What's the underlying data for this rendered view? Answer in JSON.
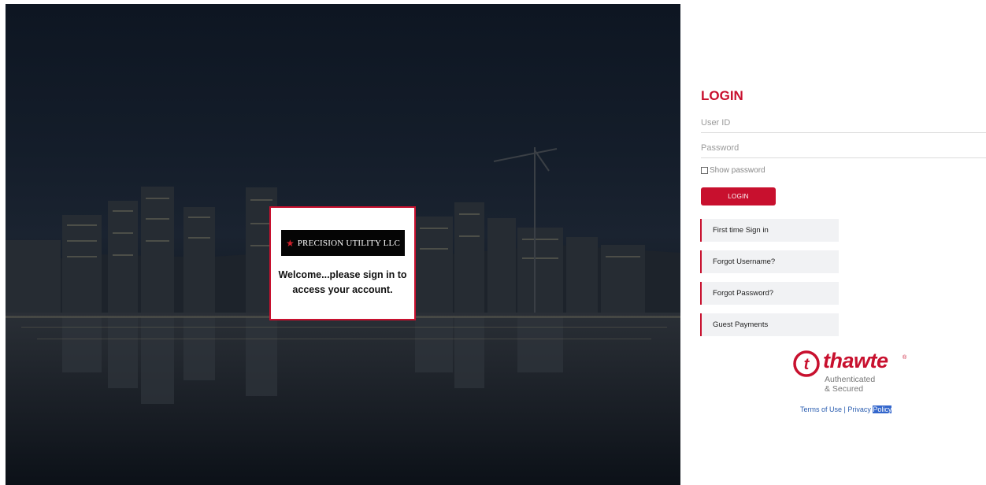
{
  "brand": {
    "name": "PRECISION UTILITY LLC",
    "star_glyph": "★",
    "welcome_message": "Welcome...please sign in to access your account."
  },
  "login": {
    "title": "LOGIN",
    "user_id_placeholder": "User ID",
    "password_placeholder": "Password",
    "show_password_label": "Show password",
    "submit_label": "LOGIN"
  },
  "links": [
    {
      "label": "First time Sign in"
    },
    {
      "label": "Forgot Username?"
    },
    {
      "label": "Forgot Password?"
    },
    {
      "label": "Guest Payments"
    }
  ],
  "seal": {
    "logo_letter": "t",
    "brand": "thawte",
    "registered": "®",
    "line1": "Authenticated",
    "line2": "& Secured"
  },
  "footer": {
    "terms": "Terms of Use",
    "separator": " | ",
    "privacy_1": "Privacy ",
    "privacy_2": "Policy"
  },
  "colors": {
    "accent": "#c8102e",
    "link": "#2a5db0"
  }
}
